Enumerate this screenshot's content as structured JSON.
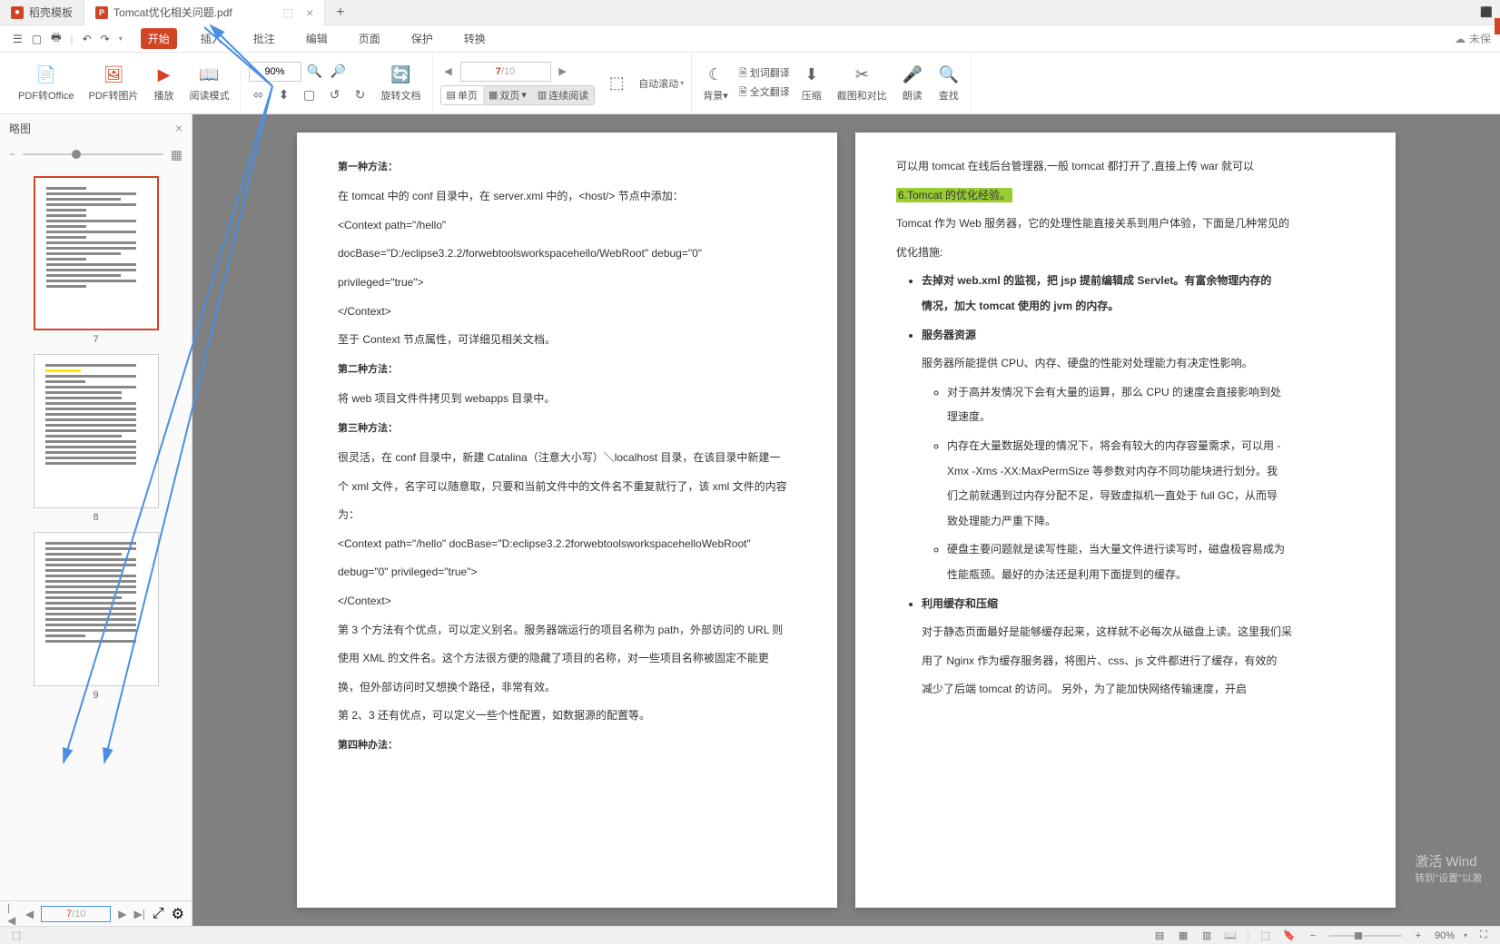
{
  "tabs": {
    "tab1": "稻壳模板",
    "tab2": "Tomcat优化相关问题.pdf",
    "float_icon": "⬚"
  },
  "menubar": {
    "icons": {
      "menu": "☰",
      "open": "📁",
      "print": "🖶",
      "undo": "↶",
      "redo": "↷",
      "dropdown": "▾"
    },
    "items": [
      "开始",
      "插入",
      "批注",
      "编辑",
      "页面",
      "保护",
      "转换"
    ],
    "right": "未保"
  },
  "toolbar": {
    "pdf_office": "PDF转Office",
    "pdf_image": "PDF转图片",
    "play": "播放",
    "read_mode": "阅读模式",
    "zoom_value": "90%",
    "rotate": "旋转文档",
    "page_current": "7",
    "page_total": "/10",
    "single_page": "单页",
    "double_page": "双页",
    "continuous": "连续阅读",
    "auto_scroll": "自动滚动",
    "background": "背景",
    "text_translate": "划词翻译",
    "full_translate": "全文翻译",
    "compress": "压缩",
    "crop_compare": "截图和对比",
    "read_aloud": "朗读",
    "find": "查找"
  },
  "sidebar": {
    "title": "略图",
    "thumbs": [
      {
        "num": "7",
        "selected": true
      },
      {
        "num": "8",
        "selected": false
      },
      {
        "num": "9",
        "selected": false
      }
    ],
    "footer_current": "7",
    "footer_total": "/10"
  },
  "doc_left": {
    "h1": "第一种方法：",
    "p1": "在 tomcat 中的 conf 目录中，在 server.xml 中的，<host/> 节点中添加：",
    "p2": "<Context path=\"/hello\"",
    "p3": "docBase=\"D:/eclipse3.2.2/forwebtoolsworkspacehello/WebRoot\" debug=\"0\"",
    "p4": "privileged=\"true\">",
    "p5": "</Context>",
    "p6": "至于 Context 节点属性，可详细见相关文档。",
    "h2": "第二种方法：",
    "p7": "将 web 项目文件件拷贝到 webapps  目录中。",
    "h3": "第三种方法：",
    "p8": "很灵活，在 conf 目录中，新建  Catalina（注意大小写）＼localhost 目录，在该目录中新建一",
    "p9": "个 xml 文件，名字可以随意取，只要和当前文件中的文件名不重复就行了，该 xml 文件的内容",
    "p10": "为：",
    "p11": "<Context path=\"/hello\" docBase=\"D:eclipse3.2.2forwebtoolsworkspacehelloWebRoot\"",
    "p12": "debug=\"0\" privileged=\"true\">",
    "p13": "</Context>",
    "p14": "第 3 个方法有个优点，可以定义别名。服务器端运行的项目名称为 path，外部访问的 URL 则",
    "p15": "使用 XML 的文件名。这个方法很方便的隐藏了项目的名称，对一些项目名称被固定不能更",
    "p16": "换，但外部访问时又想换个路径，非常有效。",
    "p17": "第 2、3 还有优点，可以定义一些个性配置，如数据源的配置等。",
    "h4": "第四种办法："
  },
  "doc_right": {
    "p1": "可以用 tomcat 在线后台管理器,一般 tomcat 都打开了,直接上传 war 就可以",
    "highlight": "6.Tomcat  的优化经验。",
    "p2": "Tomcat  作为  Web  服务器，它的处理性能直接关系到用户体验，下面是几种常见的",
    "p3": "优化措施:",
    "li1": "去掉对  web.xml  的监视，把  jsp  提前编辑成  Servlet。有富余物理内存的",
    "li1b": "情况，加大  tomcat  使用的  jvm  的内存。",
    "li2": "服务器资源",
    "p4": "服务器所能提供  CPU、内存、硬盘的性能对处理能力有决定性影响。",
    "sub1": "对于高并发情况下会有大量的运算，那么 CPU 的速度会直接影响到处",
    "sub1b": "理速度。",
    "sub2": "内存在大量数据处理的情况下，将会有较大的内存容量需求，可以用 -",
    "sub2b": "Xmx -Xms -XX:MaxPermSize 等参数对内存不同功能块进行划分。我",
    "sub2c": "们之前就遇到过内存分配不足，导致虚拟机一直处于  full GC，从而导",
    "sub2d": "致处理能力严重下降。",
    "sub3": "硬盘主要问题就是读写性能，当大量文件进行读写时，磁盘极容易成为",
    "sub3b": "性能瓶颈。最好的办法还是利用下面提到的缓存。",
    "li3": "利用缓存和压缩",
    "p5": "对于静态页面最好是能够缓存起来，这样就不必每次从磁盘上读。这里我们采",
    "p6": "用了  Nginx  作为缓存服务器，将图片、css、js  文件都进行了缓存，有效的",
    "p7": "减少了后端  tomcat  的访问。          另外，为了能加快网络传输速度，开启"
  },
  "watermark": {
    "l1": "激活 Wind",
    "l2": "转到\"设置\"以激"
  },
  "statusbar": {
    "zoom": "90%"
  }
}
